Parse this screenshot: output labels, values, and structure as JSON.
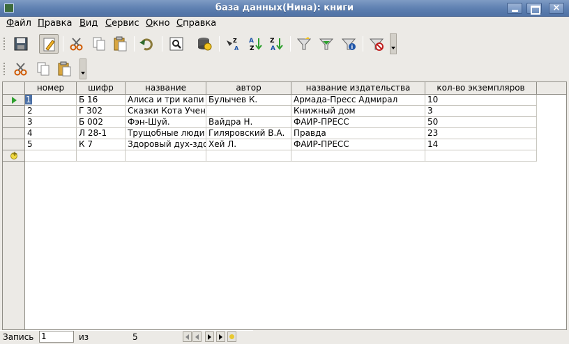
{
  "window": {
    "title": "база данных(Нина): книги",
    "close_glyph": "×"
  },
  "menu": [
    "Файл",
    "Правка",
    "Вид",
    "Сервис",
    "Окно",
    "Справка"
  ],
  "toolbar1": [
    {
      "name": "save-icon"
    },
    {
      "name": "edit-pencil-icon",
      "pressed": true
    },
    {
      "name": "cut-icon"
    },
    {
      "name": "copy-icon"
    },
    {
      "name": "paste-icon"
    },
    {
      "name": "undo-icon"
    },
    {
      "name": "find-record-icon"
    },
    {
      "name": "refresh-db-icon"
    },
    {
      "name": "sort-icon"
    },
    {
      "name": "sort-ascending-icon"
    },
    {
      "name": "sort-descending-icon"
    },
    {
      "name": "autofilter-icon"
    },
    {
      "name": "standard-filter-icon"
    },
    {
      "name": "apply-filter-icon"
    },
    {
      "name": "remove-filter-icon"
    }
  ],
  "toolbar2": [
    {
      "name": "cut-icon"
    },
    {
      "name": "copy-icon"
    },
    {
      "name": "paste-icon"
    }
  ],
  "table": {
    "columns": [
      "номер",
      "шифр",
      "название",
      "автор",
      "название издательства",
      "кол-во экземпляров"
    ],
    "rows": [
      [
        "1",
        "Б 16",
        "Алиса и три капи",
        "Булычев К.",
        "Армада-Пресс Адмирал",
        "10"
      ],
      [
        "2",
        "Г 302",
        "Сказки Кота Учен",
        "",
        "Книжный дом",
        "3"
      ],
      [
        "3",
        "Б 002",
        "Фэн-Шуй.",
        "Вайдра Н.",
        "ФАИР-ПРЕСС",
        "50"
      ],
      [
        "4",
        "Л 28-1",
        "Трущобные люди",
        "Гиляровский В.А.",
        "Правда",
        "23"
      ],
      [
        "5",
        "К 7",
        "Здоровый дух-здо",
        "Хей Л.",
        "ФАИР-ПРЕСС",
        "14"
      ]
    ]
  },
  "navigator": {
    "record_label": "Запись",
    "record_value": "1",
    "of_label": "из",
    "total": "5"
  },
  "colors": {
    "titlebar": "#5d7fb0",
    "indicator": "#2ea02e",
    "selection": "#4a6fa5"
  }
}
